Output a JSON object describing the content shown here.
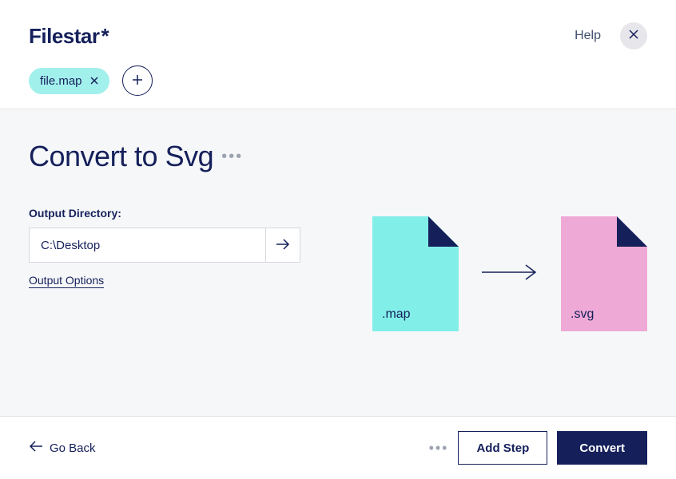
{
  "header": {
    "logo": "Filestar",
    "logo_suffix": "*",
    "help_label": "Help"
  },
  "files": {
    "chip_label": "file.map"
  },
  "main": {
    "title": "Convert to Svg",
    "output_dir_label": "Output Directory:",
    "output_dir_value": "C:\\Desktop",
    "output_options_label": "Output Options"
  },
  "diagram": {
    "from_ext": ".map",
    "to_ext": ".svg"
  },
  "footer": {
    "go_back_label": "Go Back",
    "add_step_label": "Add Step",
    "convert_label": "Convert"
  }
}
